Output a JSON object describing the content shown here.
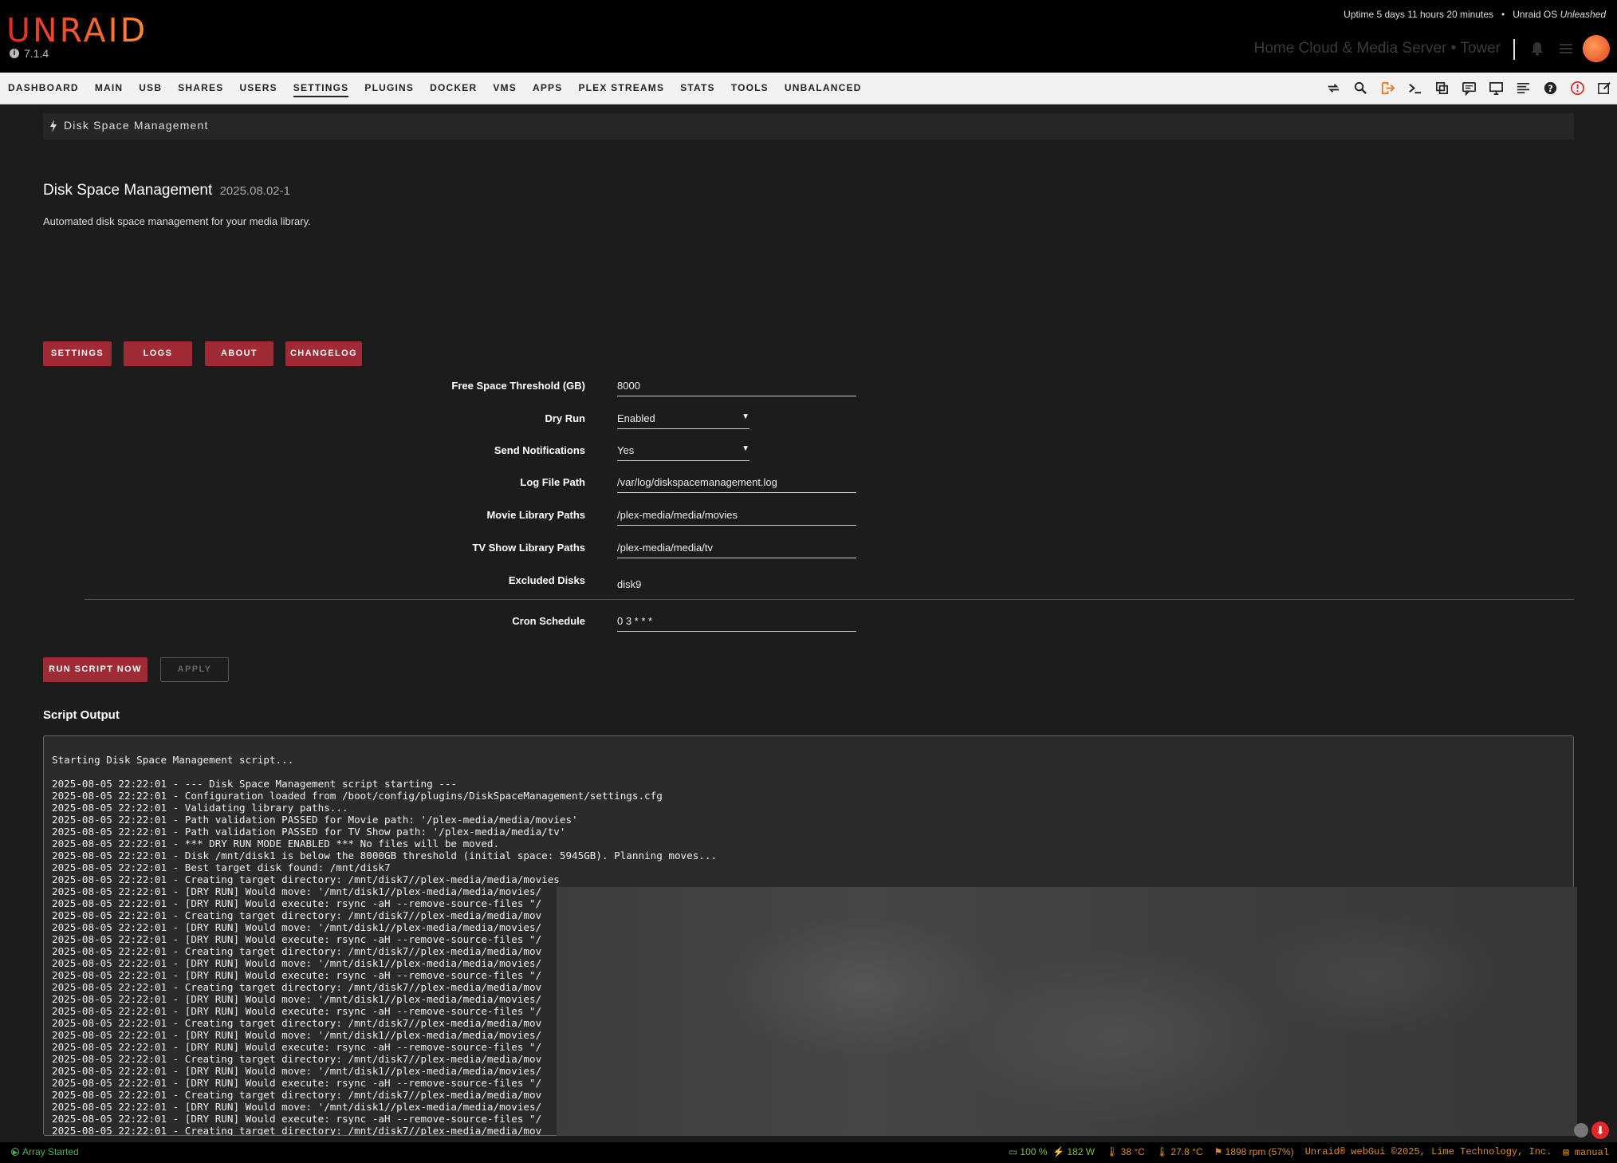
{
  "header": {
    "logo": "UNRAID",
    "version": "7.1.4",
    "uptime": "Uptime 5 days 11 hours 20 minutes",
    "os_prefix": "Unraid OS",
    "os_edition": "Unleashed",
    "server": "Home Cloud & Media Server • Tower"
  },
  "nav": {
    "tabs": [
      "DASHBOARD",
      "MAIN",
      "USB",
      "SHARES",
      "USERS",
      "SETTINGS",
      "PLUGINS",
      "DOCKER",
      "VMS",
      "APPS",
      "PLEX STREAMS",
      "STATS",
      "TOOLS",
      "UNBALANCED"
    ],
    "active": "SETTINGS",
    "icons": [
      "refresh-icon",
      "search-icon",
      "logout-icon",
      "terminal-icon",
      "copy-icon",
      "feedback-icon",
      "display-icon",
      "log-icon",
      "help-icon",
      "alert-icon",
      "edit-icon"
    ]
  },
  "breadcrumb": "Disk Space Management",
  "page": {
    "title": "Disk Space Management",
    "version": "2025.08.02-1",
    "description": "Automated disk space management for your media library."
  },
  "tabs": {
    "settings": "SETTINGS",
    "logs": "LOGS",
    "about": "ABOUT",
    "changelog": "CHANGELOG"
  },
  "form": {
    "threshold_label": "Free Space Threshold (GB)",
    "threshold_value": "8000",
    "dryrun_label": "Dry Run",
    "dryrun_value": "Enabled",
    "notify_label": "Send Notifications",
    "notify_value": "Yes",
    "logpath_label": "Log File Path",
    "logpath_value": "/var/log/diskspacemanagement.log",
    "movies_label": "Movie Library Paths",
    "movies_value": "/plex-media/media/movies",
    "tv_label": "TV Show Library Paths",
    "tv_value": "/plex-media/media/tv",
    "excluded_label": "Excluded Disks",
    "excluded_value": "disk9",
    "cron_label": "Cron Schedule",
    "cron_value": "0 3 * * *"
  },
  "actions": {
    "run": "RUN SCRIPT NOW",
    "apply": "APPLY"
  },
  "output": {
    "title": "Script Output",
    "lines": [
      "Starting Disk Space Management script...",
      "",
      "2025-08-05 22:22:01 - --- Disk Space Management script starting ---",
      "2025-08-05 22:22:01 - Configuration loaded from /boot/config/plugins/DiskSpaceManagement/settings.cfg",
      "2025-08-05 22:22:01 - Validating library paths...",
      "2025-08-05 22:22:01 - Path validation PASSED for Movie path: '/plex-media/media/movies'",
      "2025-08-05 22:22:01 - Path validation PASSED for TV Show path: '/plex-media/media/tv'",
      "2025-08-05 22:22:01 - *** DRY RUN MODE ENABLED *** No files will be moved.",
      "2025-08-05 22:22:01 - Disk /mnt/disk1 is below the 8000GB threshold (initial space: 5945GB). Planning moves...",
      "2025-08-05 22:22:01 - Best target disk found: /mnt/disk7",
      "2025-08-05 22:22:01 - Creating target directory: /mnt/disk7//plex-media/media/movies",
      "2025-08-05 22:22:01 - [DRY RUN] Would move: '/mnt/disk1//plex-media/media/movies/",
      "2025-08-05 22:22:01 - [DRY RUN] Would execute: rsync -aH --remove-source-files \"/",
      "2025-08-05 22:22:01 - Creating target directory: /mnt/disk7//plex-media/media/mov",
      "2025-08-05 22:22:01 - [DRY RUN] Would move: '/mnt/disk1//plex-media/media/movies/",
      "2025-08-05 22:22:01 - [DRY RUN] Would execute: rsync -aH --remove-source-files \"/",
      "2025-08-05 22:22:01 - Creating target directory: /mnt/disk7//plex-media/media/mov",
      "2025-08-05 22:22:01 - [DRY RUN] Would move: '/mnt/disk1//plex-media/media/movies/",
      "2025-08-05 22:22:01 - [DRY RUN] Would execute: rsync -aH --remove-source-files \"/",
      "2025-08-05 22:22:01 - Creating target directory: /mnt/disk7//plex-media/media/mov",
      "2025-08-05 22:22:01 - [DRY RUN] Would move: '/mnt/disk1//plex-media/media/movies/",
      "2025-08-05 22:22:01 - [DRY RUN] Would execute: rsync -aH --remove-source-files \"/",
      "2025-08-05 22:22:01 - Creating target directory: /mnt/disk7//plex-media/media/mov",
      "2025-08-05 22:22:01 - [DRY RUN] Would move: '/mnt/disk1//plex-media/media/movies/",
      "2025-08-05 22:22:01 - [DRY RUN] Would execute: rsync -aH --remove-source-files \"/",
      "2025-08-05 22:22:01 - Creating target directory: /mnt/disk7//plex-media/media/mov",
      "2025-08-05 22:22:01 - [DRY RUN] Would move: '/mnt/disk1//plex-media/media/movies/",
      "2025-08-05 22:22:01 - [DRY RUN] Would execute: rsync -aH --remove-source-files \"/",
      "2025-08-05 22:22:01 - Creating target directory: /mnt/disk7//plex-media/media/mov",
      "2025-08-05 22:22:01 - [DRY RUN] Would move: '/mnt/disk1//plex-media/media/movies/",
      "2025-08-05 22:22:01 - [DRY RUN] Would execute: rsync -aH --remove-source-files \"/",
      "2025-08-05 22:22:01 - Creating target directory: /mnt/disk7//plex-media/media/mov"
    ]
  },
  "footer": {
    "array": "Array Started",
    "battery": "100 %",
    "power": "182 W",
    "temp1": "38 °C",
    "temp2": "27.8 °C",
    "fan": "1898 rpm (57%)",
    "copyright": "Unraid® webGui ©2025, Lime Technology, Inc.",
    "mode": "manual"
  },
  "colors": {
    "accent": "#9e2b35",
    "brand": "#f15a2c",
    "status_ok": "#4caf50",
    "status_warn": "#d68b2a"
  }
}
